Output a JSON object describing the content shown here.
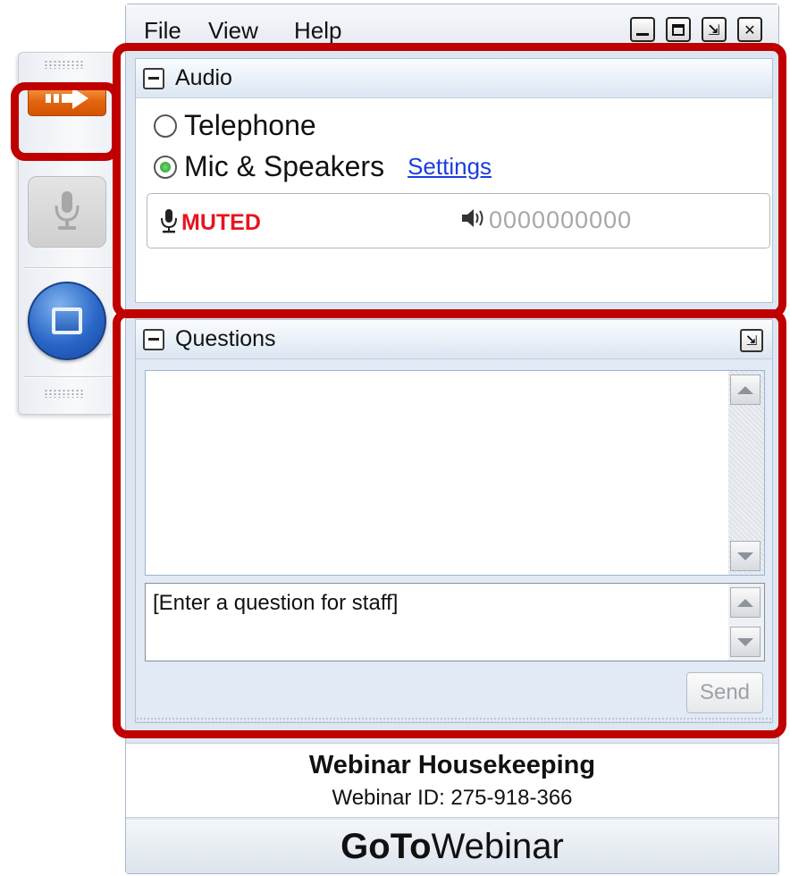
{
  "menubar": {
    "items": [
      {
        "label": "File"
      },
      {
        "label": "View"
      },
      {
        "label": "Help"
      }
    ],
    "window_controls": [
      "minimize-icon",
      "maximize-icon",
      "popout-icon",
      "close-icon"
    ]
  },
  "grab_tab": {
    "buttons": [
      "show-panel-arrow-icon",
      "microphone-icon",
      "screen-share-icon"
    ]
  },
  "audio": {
    "title": "Audio",
    "options": [
      {
        "label": "Telephone",
        "selected": false
      },
      {
        "label": "Mic & Speakers",
        "selected": true
      }
    ],
    "settings_link": "Settings",
    "mic_status": "MUTED",
    "level_meter": "0000000000",
    "colors": {
      "muted": "#e8141e",
      "link": "#1a3ee0"
    }
  },
  "questions": {
    "title": "Questions",
    "input_placeholder": "[Enter a question for staff]",
    "send_label": "Send"
  },
  "footer": {
    "title": "Webinar Housekeeping",
    "webinar_id": "Webinar ID: 275-918-366",
    "brand_bold": "GoTo",
    "brand_light": "Webinar"
  },
  "highlight_color": "#c00000"
}
